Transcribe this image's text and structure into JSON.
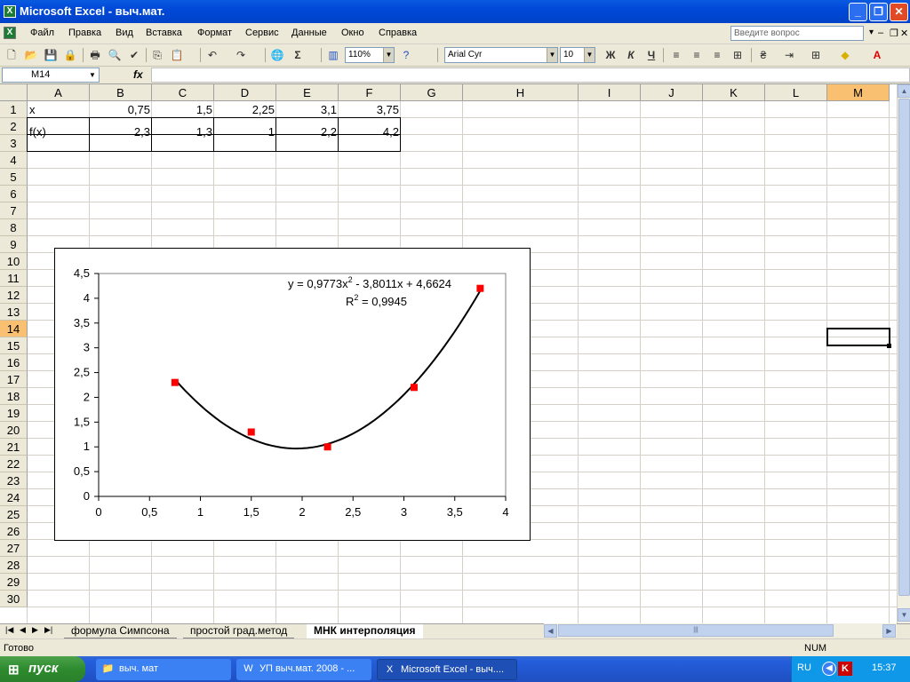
{
  "window": {
    "title": "Microsoft Excel - выч.мат."
  },
  "menu": {
    "items": [
      "Файл",
      "Правка",
      "Вид",
      "Вставка",
      "Формат",
      "Сервис",
      "Данные",
      "Окно",
      "Справка"
    ],
    "help_placeholder": "Введите вопрос"
  },
  "toolbar": {
    "zoom": "110%",
    "font_name": "Arial Cyr",
    "font_size": "10",
    "bold": "Ж",
    "italic": "К",
    "underline": "Ч"
  },
  "formula_bar": {
    "name_box": "M14",
    "fx": "fx",
    "value": ""
  },
  "columns": [
    "A",
    "B",
    "C",
    "D",
    "E",
    "F",
    "G",
    "H",
    "I",
    "J",
    "K",
    "L",
    "M"
  ],
  "selected_cell": {
    "column": "M",
    "row": "14"
  },
  "rows": [
    "1",
    "2",
    "3",
    "4",
    "5",
    "6",
    "7",
    "8",
    "9",
    "10",
    "11",
    "12",
    "13",
    "14",
    "15",
    "16",
    "17",
    "18",
    "19",
    "20",
    "21",
    "22",
    "23",
    "24",
    "25",
    "26",
    "27",
    "28",
    "29",
    "30"
  ],
  "cells": {
    "A1": "x",
    "B1": "0,75",
    "C1": "1,5",
    "D1": "2,25",
    "E1": "3,1",
    "F1": "3,75",
    "A2": "f(x)",
    "B2": "2,3",
    "C2": "1,3",
    "D2": "1",
    "E2": "2,2",
    "F2": "4,2"
  },
  "chart_data": {
    "type": "scatter",
    "series": [
      {
        "x": [
          0.75,
          1.5,
          2.25,
          3.1,
          3.75
        ],
        "y": [
          2.3,
          1.3,
          1,
          2.2,
          4.2
        ],
        "color": "#ff0000",
        "marker": "square"
      }
    ],
    "trendline": {
      "type": "polynomial",
      "coefficients": [
        0.9773,
        -3.8011,
        4.6624
      ],
      "x_range": [
        0.75,
        3.75
      ],
      "color": "#000000"
    },
    "trend_equation": "y = 0,9773x",
    "trend_equation_rest": " - 3,8011x + 4,6624",
    "exponent": "2",
    "r_squared_label": "R",
    "r_squared_value": " = 0,9945",
    "xlim": [
      0,
      4
    ],
    "ylim": [
      0,
      4.5
    ],
    "x_ticks": [
      "0",
      "0,5",
      "1",
      "1,5",
      "2",
      "2,5",
      "3",
      "3,5",
      "4"
    ],
    "y_ticks": [
      "0",
      "0,5",
      "1",
      "1,5",
      "2",
      "2,5",
      "3",
      "3,5",
      "4",
      "4,5"
    ],
    "grid": false
  },
  "sheets": {
    "tabs": [
      "формула Симпсона",
      "простой град.метод",
      "МНК интерполяция"
    ],
    "active_tab": "МНК интерполяция"
  },
  "status": {
    "left": "Готово",
    "num": "NUM"
  },
  "taskbar": {
    "start": "пуск",
    "tasks": [
      "выч. мат",
      "УП выч.мат. 2008 - ...",
      "Microsoft Excel - выч...."
    ],
    "lang": "RU",
    "clock": "15:37"
  }
}
